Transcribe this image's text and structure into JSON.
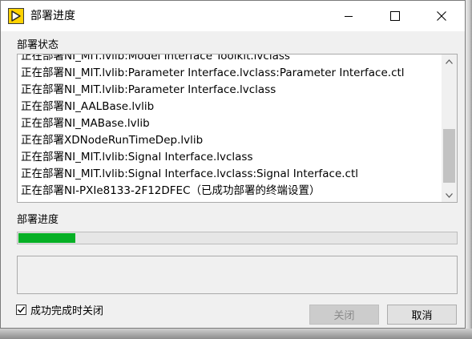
{
  "window": {
    "title": "部署进度",
    "icon": "labview-arrow-icon",
    "controls": [
      "minimize-icon",
      "maximize-icon",
      "close-icon"
    ]
  },
  "status_label": "部署状态",
  "status_lines": [
    "正在部署NI_MIT.lvlib:Model Interface Toolkit.lvclass",
    "正在部署NI_MIT.lvlib:Parameter Interface.lvclass:Parameter Interface.ctl",
    "正在部署NI_MIT.lvlib:Parameter Interface.lvclass",
    "正在部署NI_AALBase.lvlib",
    "正在部署NI_MABase.lvlib",
    "正在部署XDNodeRunTimeDep.lvlib",
    "正在部署NI_MIT.lvlib:Signal Interface.lvclass",
    "正在部署NI_MIT.lvlib:Signal Interface.lvclass:Signal Interface.ctl",
    "正在部署NI-PXIe8133-2F12DFEC（已成功部署的终端设置）"
  ],
  "progress_label": "部署进度",
  "progress": {
    "fraction": 0.13,
    "color": "#06b025"
  },
  "close_on_success_label": "成功完成时关闭",
  "close_on_success_checked": true,
  "close_button_label": "关闭",
  "cancel_button_label": "取消"
}
